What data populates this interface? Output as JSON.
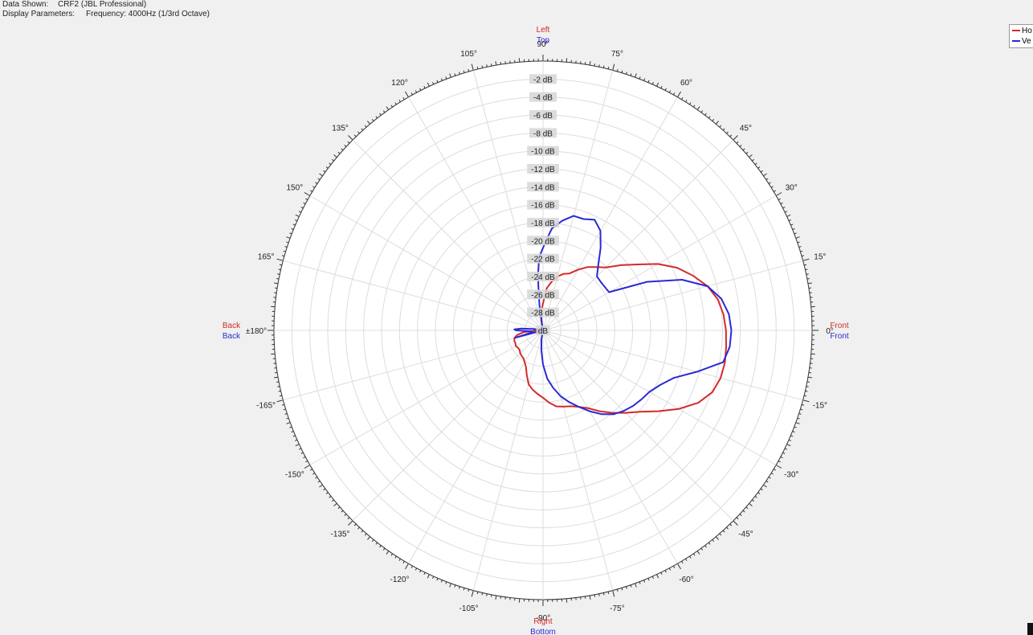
{
  "header": {
    "data_shown_label": "Data Shown:",
    "data_shown_value": "CRF2 (JBL Professional)",
    "display_params_label": "Display Parameters:",
    "display_params_value": "Frequency: 4000Hz (1/3rd Octave)"
  },
  "colors": {
    "horizontal": "#d42a2a",
    "vertical": "#2a2ad4",
    "grid": "#dcdcdc",
    "ring_label_bg": "#d6d6d6",
    "background": "#f0f0f0",
    "plot_bg": "#ffffff"
  },
  "legend": {
    "items": [
      {
        "label": "Ho",
        "color": "#d42a2a"
      },
      {
        "label": "Ve",
        "color": "#2a2ad4"
      }
    ]
  },
  "axis_labels": {
    "top_h": "Left",
    "top_v": "Top",
    "bottom_h": "Right",
    "bottom_v": "Bottom",
    "left_h": "Back",
    "left_v": "Back",
    "right_h": "Front",
    "right_v": "Front"
  },
  "chart_data": {
    "type": "polar",
    "angle_unit": "degrees",
    "radial_unit": "dB",
    "rlim": [
      -30,
      0
    ],
    "grid": true,
    "legend_position": "top-right",
    "radial_ticks": [
      "-2 dB",
      "-4 dB",
      "-6 dB",
      "-8 dB",
      "-10 dB",
      "-12 dB",
      "-14 dB",
      "-16 dB",
      "-18 dB",
      "-20 dB",
      "-22 dB",
      "-24 dB",
      "-26 dB",
      "-28 dB",
      "dB"
    ],
    "angle_ticks": [
      {
        "angle": 0,
        "label": "0°"
      },
      {
        "angle": 15,
        "label": "15°"
      },
      {
        "angle": 30,
        "label": "30°"
      },
      {
        "angle": 45,
        "label": "45°"
      },
      {
        "angle": 60,
        "label": "60°"
      },
      {
        "angle": 75,
        "label": "75°"
      },
      {
        "angle": 90,
        "label": "90°"
      },
      {
        "angle": 105,
        "label": "105°"
      },
      {
        "angle": 120,
        "label": "120°"
      },
      {
        "angle": 135,
        "label": "135°"
      },
      {
        "angle": 150,
        "label": "150°"
      },
      {
        "angle": 165,
        "label": "165°"
      },
      {
        "angle": 180,
        "label": "±180°"
      },
      {
        "angle": -165,
        "label": "-165°"
      },
      {
        "angle": -150,
        "label": "-150°"
      },
      {
        "angle": -135,
        "label": "-135°"
      },
      {
        "angle": -120,
        "label": "-120°"
      },
      {
        "angle": -105,
        "label": "-105°"
      },
      {
        "angle": -90,
        "label": "-90°"
      },
      {
        "angle": -75,
        "label": "-75°"
      },
      {
        "angle": -60,
        "label": "-60°"
      },
      {
        "angle": -45,
        "label": "-45°"
      },
      {
        "angle": -30,
        "label": "-30°"
      },
      {
        "angle": -15,
        "label": "-15°"
      }
    ],
    "series": [
      {
        "name": "Ho",
        "points": [
          [
            0,
            -9.6
          ],
          [
            -5,
            -9.5
          ],
          [
            -10,
            -9.4
          ],
          [
            -15,
            -9.5
          ],
          [
            -20,
            -9.9
          ],
          [
            -25,
            -10.9
          ],
          [
            -30,
            -12.5
          ],
          [
            -35,
            -14.3
          ],
          [
            -40,
            -15.9
          ],
          [
            -45,
            -17.0
          ],
          [
            -50,
            -18.0
          ],
          [
            -55,
            -19.0
          ],
          [
            -60,
            -20.0
          ],
          [
            -65,
            -20.6
          ],
          [
            -70,
            -21.0
          ],
          [
            -75,
            -21.2
          ],
          [
            -80,
            -21.4
          ],
          [
            -85,
            -21.9
          ],
          [
            -90,
            -22.5
          ],
          [
            -95,
            -22.9
          ],
          [
            -100,
            -23.3
          ],
          [
            -105,
            -23.8
          ],
          [
            -110,
            -24.7
          ],
          [
            -115,
            -25.5
          ],
          [
            -120,
            -25.9
          ],
          [
            -125,
            -26.2
          ],
          [
            -130,
            -26.3
          ],
          [
            -135,
            -26.4
          ],
          [
            -140,
            -26.6
          ],
          [
            -145,
            -26.6
          ],
          [
            -150,
            -26.5
          ],
          [
            -155,
            -26.6
          ],
          [
            -160,
            -26.6
          ],
          [
            -165,
            -26.7
          ],
          [
            -170,
            -27.1
          ],
          [
            -175,
            -27.9
          ],
          [
            -180,
            -30.0
          ],
          [
            175,
            -29.0
          ],
          [
            170,
            -30.0
          ],
          [
            120,
            -30.0
          ],
          [
            100,
            -29.0
          ],
          [
            95,
            -27.8
          ],
          [
            90,
            -27.0
          ],
          [
            85,
            -25.3
          ],
          [
            80,
            -24.5
          ],
          [
            75,
            -23.8
          ],
          [
            70,
            -23.3
          ],
          [
            65,
            -23.0
          ],
          [
            60,
            -22.2
          ],
          [
            55,
            -21.4
          ],
          [
            50,
            -20.8
          ],
          [
            45,
            -20.1
          ],
          [
            40,
            -18.7
          ],
          [
            35,
            -17.2
          ],
          [
            30,
            -15.2
          ],
          [
            25,
            -13.5
          ],
          [
            20,
            -12.2
          ],
          [
            15,
            -11.0
          ],
          [
            10,
            -10.2
          ],
          [
            5,
            -9.8
          ],
          [
            0,
            -9.6
          ]
        ]
      },
      {
        "name": "Ve",
        "points": [
          [
            0,
            -9.0
          ],
          [
            -5,
            -9.1
          ],
          [
            -10,
            -9.6
          ],
          [
            -15,
            -12.2
          ],
          [
            -20,
            -14.5
          ],
          [
            -25,
            -15.6
          ],
          [
            -30,
            -16.3
          ],
          [
            -35,
            -16.6
          ],
          [
            -40,
            -16.9
          ],
          [
            -45,
            -17.3
          ],
          [
            -50,
            -17.8
          ],
          [
            -55,
            -18.6
          ],
          [
            -60,
            -19.6
          ],
          [
            -65,
            -20.6
          ],
          [
            -70,
            -21.5
          ],
          [
            -75,
            -22.4
          ],
          [
            -80,
            -23.5
          ],
          [
            -85,
            -24.6
          ],
          [
            -90,
            -26.2
          ],
          [
            -95,
            -27.8
          ],
          [
            -100,
            -29.0
          ],
          [
            -120,
            -30.0
          ],
          [
            -160,
            -30.0
          ],
          [
            -165,
            -26.8
          ],
          [
            -170,
            -28.8
          ],
          [
            -175,
            -28.7
          ],
          [
            -178,
            -28.0
          ],
          [
            -180,
            -27.0
          ],
          [
            178,
            -26.8
          ],
          [
            175,
            -27.6
          ],
          [
            172,
            -29.0
          ],
          [
            150,
            -30.0
          ],
          [
            100,
            -29.5
          ],
          [
            98,
            -27.2
          ],
          [
            96,
            -25.0
          ],
          [
            95,
            -23.7
          ],
          [
            93,
            -21.8
          ],
          [
            88,
            -20.0
          ],
          [
            85,
            -18.6
          ],
          [
            80,
            -17.6
          ],
          [
            75,
            -16.8
          ],
          [
            70,
            -16.8
          ],
          [
            65,
            -16.4
          ],
          [
            60,
            -17.2
          ],
          [
            55,
            -18.8
          ],
          [
            50,
            -20.4
          ],
          [
            45,
            -21.5
          ],
          [
            40,
            -21.6
          ],
          [
            30,
            -21.5
          ],
          [
            25,
            -17.2
          ],
          [
            20,
            -13.5
          ],
          [
            15,
            -11.0
          ],
          [
            10,
            -9.8
          ],
          [
            5,
            -9.2
          ],
          [
            0,
            -9.0
          ]
        ]
      }
    ]
  }
}
